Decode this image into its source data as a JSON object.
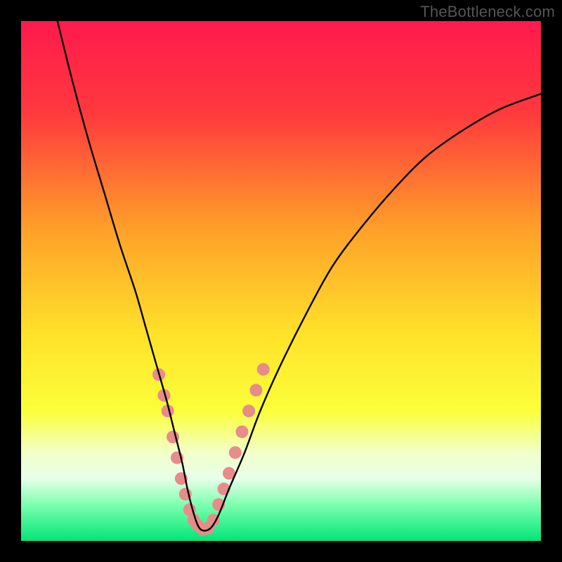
{
  "attribution": "TheBottleneck.com",
  "chart_data": {
    "type": "line",
    "title": "",
    "xlabel": "",
    "ylabel": "",
    "xlim": [
      0,
      100
    ],
    "ylim": [
      0,
      100
    ],
    "gradient_stops": [
      {
        "offset": 0,
        "color": "#ff1a4d"
      },
      {
        "offset": 18,
        "color": "#ff3a3d"
      },
      {
        "offset": 40,
        "color": "#ffa029"
      },
      {
        "offset": 60,
        "color": "#ffe12a"
      },
      {
        "offset": 75,
        "color": "#fbff39"
      },
      {
        "offset": 83,
        "color": "#f2ffca"
      },
      {
        "offset": 88,
        "color": "#e8ffe8"
      },
      {
        "offset": 93,
        "color": "#7dffb0"
      },
      {
        "offset": 100,
        "color": "#00e676"
      }
    ],
    "series": [
      {
        "name": "bottleneck-curve",
        "x": [
          7,
          10,
          13,
          16,
          19,
          22,
          24,
          26,
          28,
          29.5,
          31,
          32,
          33,
          34,
          35,
          36.5,
          38,
          40,
          43,
          46,
          50,
          55,
          60,
          66,
          72,
          78,
          85,
          92,
          100
        ],
        "y": [
          100,
          88,
          77,
          67,
          57,
          48,
          41,
          34,
          27,
          21,
          15,
          10,
          6,
          3,
          2,
          2.5,
          5,
          10,
          17,
          25,
          34,
          44,
          53,
          61,
          68,
          74,
          79,
          83,
          86
        ]
      }
    ],
    "marker_series": {
      "name": "curve-markers",
      "points": [
        {
          "x": 26.5,
          "y": 32
        },
        {
          "x": 27.5,
          "y": 28
        },
        {
          "x": 28.2,
          "y": 25
        },
        {
          "x": 29.2,
          "y": 20
        },
        {
          "x": 30.0,
          "y": 16
        },
        {
          "x": 30.8,
          "y": 12
        },
        {
          "x": 31.6,
          "y": 9
        },
        {
          "x": 32.4,
          "y": 6
        },
        {
          "x": 33.2,
          "y": 4
        },
        {
          "x": 34.0,
          "y": 3
        },
        {
          "x": 35.0,
          "y": 2.2
        },
        {
          "x": 36.0,
          "y": 2.5
        },
        {
          "x": 37.0,
          "y": 4
        },
        {
          "x": 38.0,
          "y": 7
        },
        {
          "x": 39.0,
          "y": 10
        },
        {
          "x": 40.0,
          "y": 13
        },
        {
          "x": 41.2,
          "y": 17
        },
        {
          "x": 42.5,
          "y": 21
        },
        {
          "x": 43.8,
          "y": 25
        },
        {
          "x": 45.2,
          "y": 29
        },
        {
          "x": 46.6,
          "y": 33
        }
      ],
      "radius": 9,
      "color": "#e88b8b"
    }
  }
}
